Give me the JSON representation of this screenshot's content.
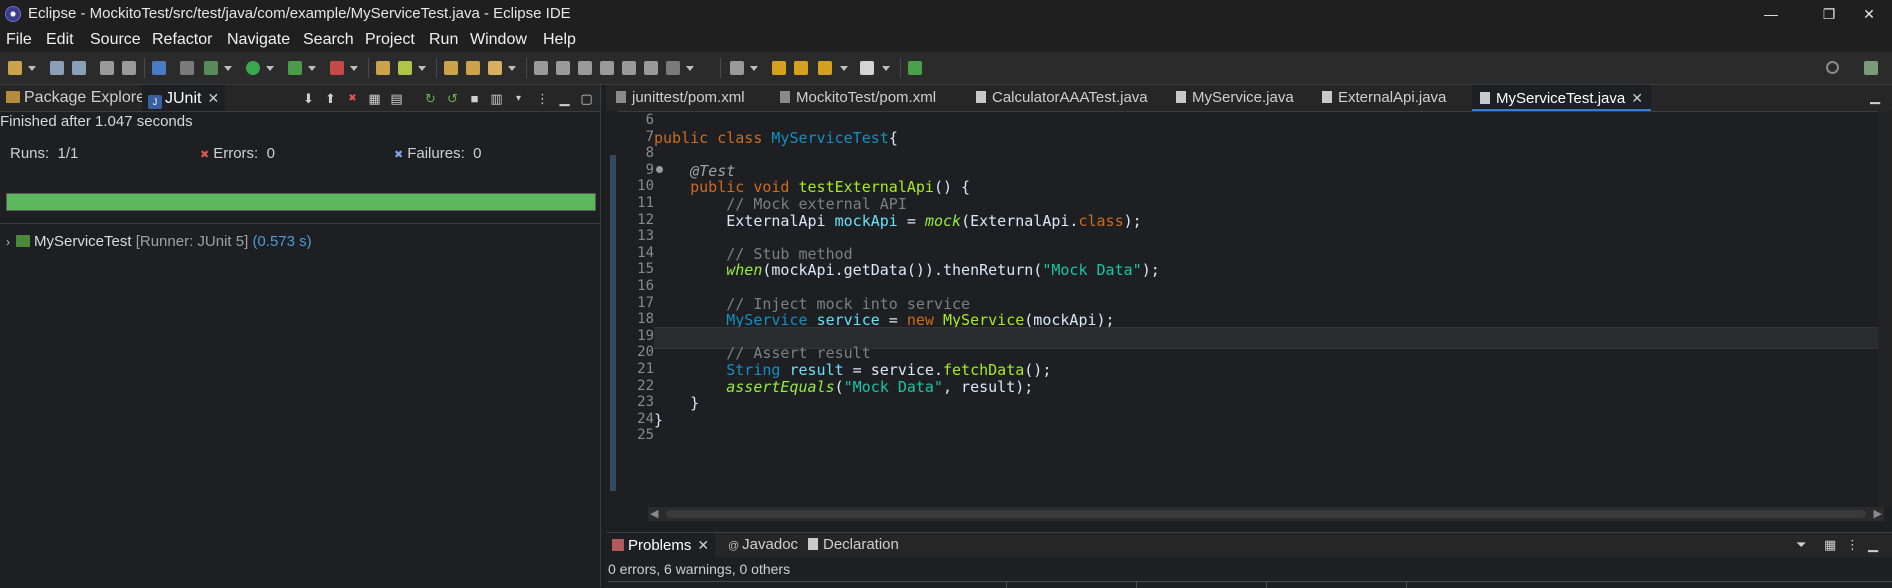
{
  "window": {
    "title": "Eclipse - MockitoTest/src/test/java/com/example/MyServiceTest.java - Eclipse IDE",
    "controls": [
      "—",
      "❐",
      "✕"
    ]
  },
  "menu": [
    "File",
    "Edit",
    "Source",
    "Refactor",
    "Navigate",
    "Search",
    "Project",
    "Run",
    "Window",
    "Help"
  ],
  "left_panel": {
    "tabs": [
      {
        "label": "Package Explorer",
        "icon": "package-icon"
      },
      {
        "label": "JUnit",
        "icon": "junit-icon",
        "active": true
      }
    ],
    "status": "Finished after 1.047 seconds",
    "runs_label": "Runs:",
    "runs_value": "1/1",
    "errors_label": "Errors:",
    "errors_value": "0",
    "failures_label": "Failures:",
    "failures_value": "0",
    "progress_fraction": 1.0,
    "tree": {
      "name": "MyServiceTest",
      "runner": "[Runner: JUnit 5]",
      "time": "(0.573 s)"
    }
  },
  "editor": {
    "tabs": [
      {
        "label": "junittest/pom.xml",
        "icon": "xml-icon"
      },
      {
        "label": "MockitoTest/pom.xml",
        "icon": "xml-icon"
      },
      {
        "label": "CalculatorAAATest.java",
        "icon": "java-icon"
      },
      {
        "label": "MyService.java",
        "icon": "java-icon"
      },
      {
        "label": "ExternalApi.java",
        "icon": "java-icon"
      },
      {
        "label": "MyServiceTest.java",
        "icon": "java-icon",
        "active": true
      }
    ],
    "line_numbers": [
      "6",
      "7",
      "8",
      "9",
      "10",
      "11",
      "12",
      "13",
      "14",
      "15",
      "16",
      "17",
      "18",
      "19",
      "20",
      "21",
      "22",
      "23",
      "24",
      "25"
    ],
    "current_line": "19",
    "code": [
      [],
      [
        [
          "kw",
          "public class "
        ],
        [
          "ty",
          "MyServiceTest"
        ],
        [
          "",
          "{"
        ]
      ],
      [],
      [
        [
          "",
          "    "
        ],
        [
          "ann",
          "@Test"
        ]
      ],
      [
        [
          "",
          "    "
        ],
        [
          "kw",
          "public void "
        ],
        [
          "fn",
          "testExternalApi"
        ],
        [
          "",
          "() {"
        ]
      ],
      [
        [
          "",
          "        "
        ],
        [
          "cm",
          "// Mock external API"
        ]
      ],
      [
        [
          "",
          "        "
        ],
        [
          "",
          "ExternalApi "
        ],
        [
          "fd",
          "mockApi"
        ],
        [
          "",
          " = "
        ],
        [
          "it",
          "mock"
        ],
        [
          "",
          "(ExternalApi."
        ],
        [
          "kw",
          "class"
        ],
        [
          "",
          ");"
        ]
      ],
      [],
      [
        [
          "",
          "        "
        ],
        [
          "cm",
          "// Stub method"
        ]
      ],
      [
        [
          "",
          "        "
        ],
        [
          "it",
          "when"
        ],
        [
          "",
          "(mockApi.getData()).thenReturn("
        ],
        [
          "st",
          "\"Mock Data\""
        ],
        [
          "",
          ");"
        ]
      ],
      [],
      [
        [
          "",
          "        "
        ],
        [
          "cm",
          "// Inject mock into service"
        ]
      ],
      [
        [
          "",
          "        "
        ],
        [
          "ty",
          "MyService "
        ],
        [
          "fd",
          "service"
        ],
        [
          "",
          " = "
        ],
        [
          "kw",
          "new "
        ],
        [
          "fn",
          "MyService"
        ],
        [
          "",
          "(mockApi);"
        ]
      ],
      [],
      [
        [
          "",
          "        "
        ],
        [
          "cm",
          "// Assert result"
        ]
      ],
      [
        [
          "",
          "        "
        ],
        [
          "ty",
          "String "
        ],
        [
          "fd",
          "result"
        ],
        [
          "",
          " = service."
        ],
        [
          "fn",
          "fetchData"
        ],
        [
          "",
          "();"
        ]
      ],
      [
        [
          "",
          "        "
        ],
        [
          "it",
          "assertEquals"
        ],
        [
          "",
          "("
        ],
        [
          "st",
          "\"Mock Data\""
        ],
        [
          "",
          ", result);"
        ]
      ],
      [
        [
          "",
          "    }"
        ]
      ],
      [
        [
          "",
          "}"
        ]
      ],
      []
    ]
  },
  "problems_panel": {
    "tabs": [
      {
        "label": "Problems",
        "icon": "problems-icon",
        "active": true
      },
      {
        "label": "Javadoc",
        "icon": "javadoc-icon"
      },
      {
        "label": "Declaration",
        "icon": "declaration-icon"
      }
    ],
    "summary": "0 errors, 6 warnings, 0 others"
  },
  "colors": {
    "progress_green": "#5cb85c",
    "keyword": "#cc6c1d",
    "type": "#1290c3",
    "string": "#17c6a3",
    "comment": "#7f7f7f"
  }
}
